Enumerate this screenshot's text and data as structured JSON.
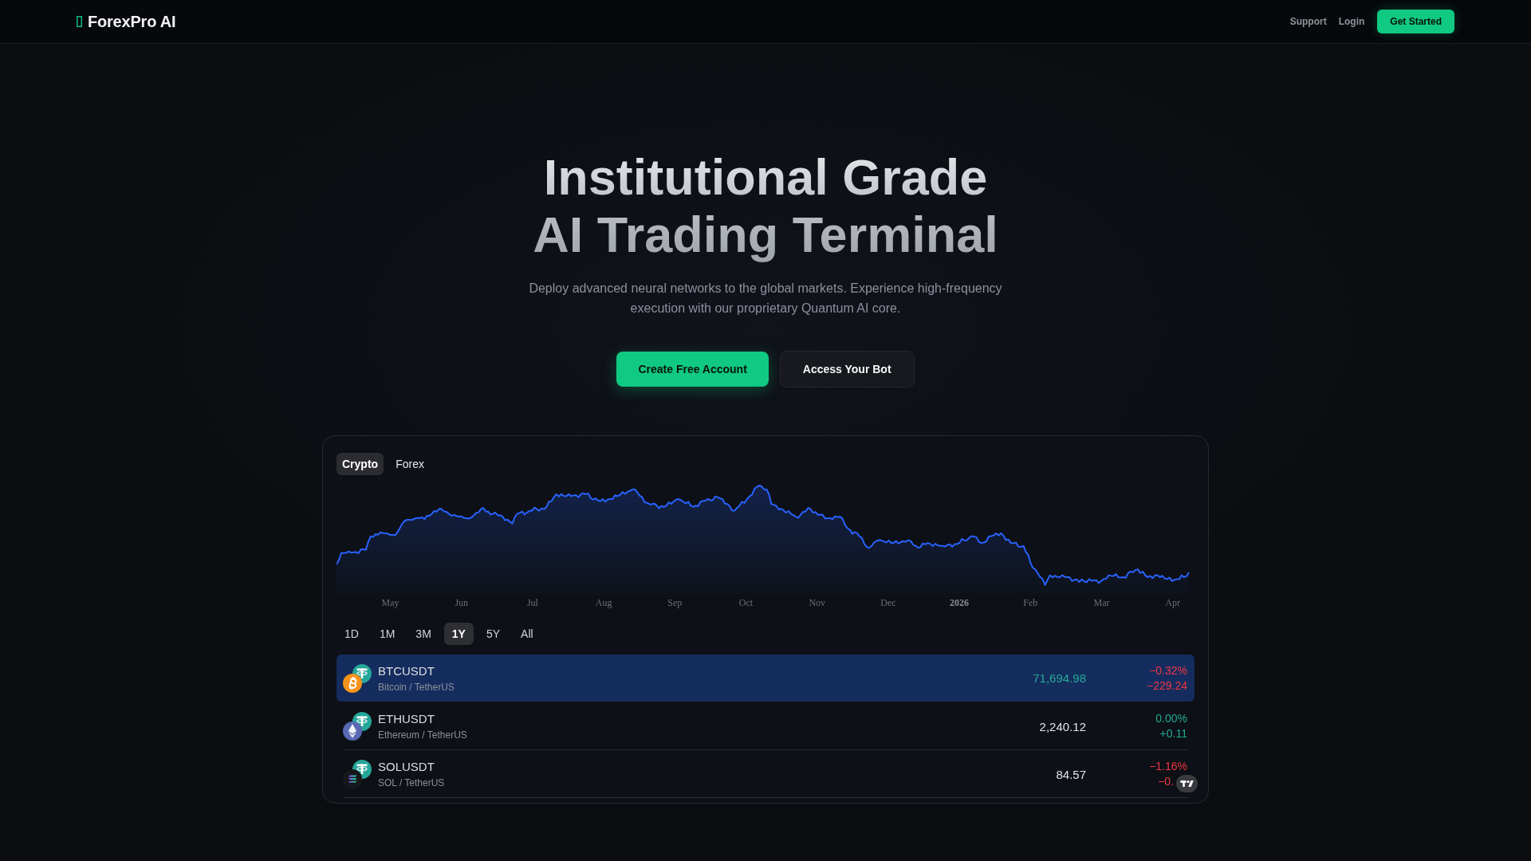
{
  "nav": {
    "logo": "ForexPro AI",
    "links": [
      "Support",
      "Login"
    ],
    "cta": "Get Started"
  },
  "hero": {
    "title": "Institutional Grade AI Trading Terminal",
    "subtitle": "Deploy advanced neural networks to the global markets. Experience high-frequency execution with our proprietary Quantum AI core.",
    "buttons": [
      {
        "label": "Create Free Account",
        "kind": "primary"
      },
      {
        "label": "Access Your Bot",
        "kind": "secondary"
      }
    ]
  },
  "widget": {
    "tabs": [
      {
        "label": "Crypto",
        "selected": true
      },
      {
        "label": "Forex",
        "selected": false
      }
    ],
    "chart": {
      "x_labels": [
        {
          "text": "May",
          "kind": "month"
        },
        {
          "text": "Jun",
          "kind": "month"
        },
        {
          "text": "Jul",
          "kind": "month"
        },
        {
          "text": "Aug",
          "kind": "month"
        },
        {
          "text": "Sep",
          "kind": "month"
        },
        {
          "text": "Oct",
          "kind": "month"
        },
        {
          "text": "Nov",
          "kind": "month"
        },
        {
          "text": "Dec",
          "kind": "month"
        },
        {
          "text": "2026",
          "kind": "year"
        },
        {
          "text": "Feb",
          "kind": "month"
        },
        {
          "text": "Mar",
          "kind": "month"
        },
        {
          "text": "Apr",
          "kind": "month"
        }
      ]
    },
    "ranges": [
      {
        "label": "1D",
        "selected": false
      },
      {
        "label": "1M",
        "selected": false
      },
      {
        "label": "3M",
        "selected": false
      },
      {
        "label": "1Y",
        "selected": true
      },
      {
        "label": "5Y",
        "selected": false
      },
      {
        "label": "All",
        "selected": false
      }
    ],
    "rows": [
      {
        "symbol": "BTCUSDT",
        "name": "Bitcoin / TetherUS",
        "kind": "btc",
        "selected": true,
        "price": "71,694.98",
        "price_flash": true,
        "change_pct": "−0.32%",
        "change_abs": "−229.24",
        "change_up": false
      },
      {
        "symbol": "ETHUSDT",
        "name": "Ethereum / TetherUS",
        "kind": "eth",
        "selected": false,
        "price": "2,240.12",
        "price_flash": false,
        "change_pct": "0.00%",
        "change_abs": "+0.11",
        "change_up": true
      },
      {
        "symbol": "SOLUSDT",
        "name": "SOL / TetherUS",
        "kind": "sol",
        "selected": false,
        "price": "84.57",
        "price_flash": false,
        "change_pct": "−1.16%",
        "change_abs": "−0.",
        "change_up": false
      }
    ],
    "badge": true
  }
}
